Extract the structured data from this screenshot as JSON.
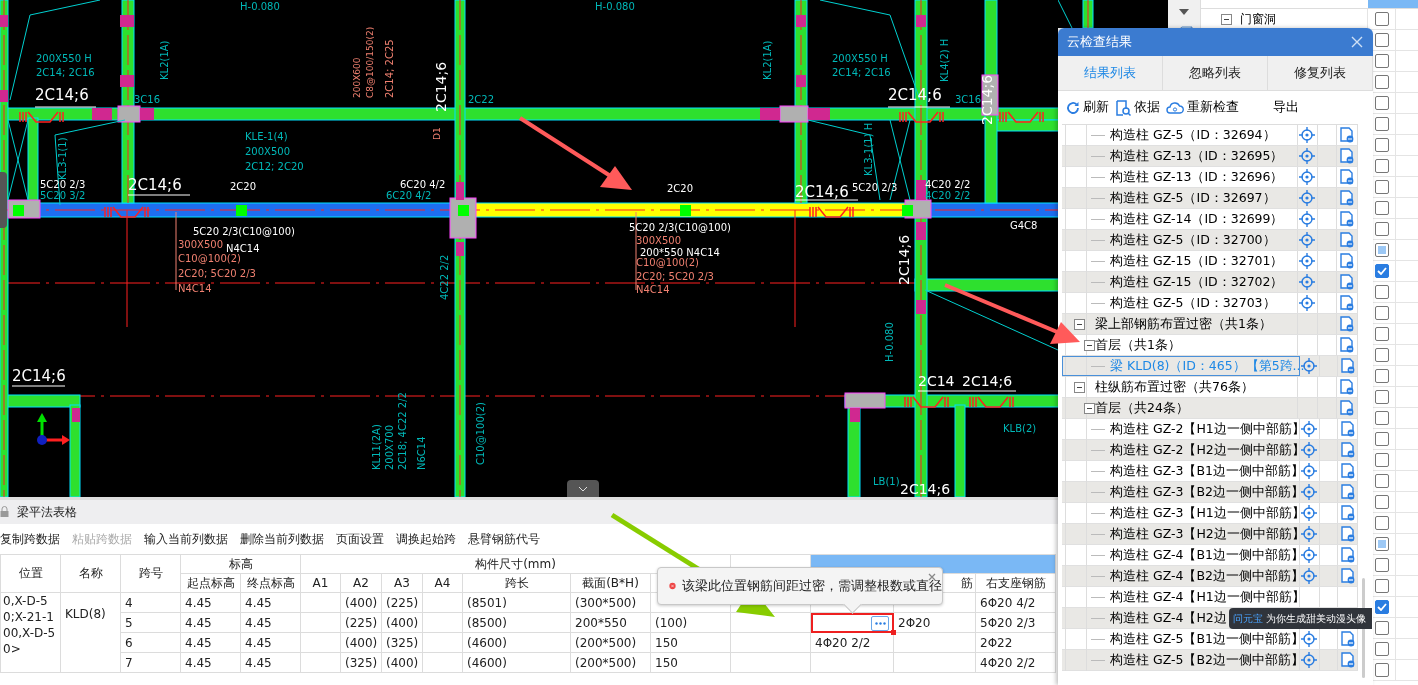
{
  "cad": {
    "labels": [
      {
        "text": "H-0.080",
        "kind": "tag"
      },
      {
        "text": "200X550 H",
        "kind": "tag"
      },
      {
        "text": "2C14; 2C16",
        "kind": "tag"
      },
      {
        "text": "KL2(1A)",
        "kind": "tag"
      },
      {
        "text": "2C14;6",
        "kind": "rebar"
      },
      {
        "text": "3C16",
        "kind": "tag"
      },
      {
        "text": "200X600",
        "kind": "note"
      },
      {
        "text": "C8@100/150(2)",
        "kind": "note"
      },
      {
        "text": "2C14; 2C25",
        "kind": "note"
      },
      {
        "text": "2C14;6",
        "kind": "rebar"
      },
      {
        "text": "2C22",
        "kind": "tag"
      },
      {
        "text": "D1",
        "kind": "note"
      },
      {
        "text": "KLE-1(4)",
        "kind": "tag"
      },
      {
        "text": "200X500",
        "kind": "tag"
      },
      {
        "text": "2C12; 2C20",
        "kind": "tag"
      },
      {
        "text": "KL3-1(1)",
        "kind": "tag"
      },
      {
        "text": "5C20 2/3",
        "kind": "rebar"
      },
      {
        "text": "5C20 3/2",
        "kind": "tag"
      },
      {
        "text": "2C14;6",
        "kind": "rebar"
      },
      {
        "text": "2C20",
        "kind": "rebar"
      },
      {
        "text": "6C20 4/2",
        "kind": "rebar"
      },
      {
        "text": "6C20 4/2",
        "kind": "tag"
      },
      {
        "text": "5C20 2/3(C10@100)",
        "kind": "rebar"
      },
      {
        "text": "300X500",
        "kind": "note"
      },
      {
        "text": "N4C14",
        "kind": "rebar"
      },
      {
        "text": "C10@100(2)",
        "kind": "note"
      },
      {
        "text": "2C20; 5C20 2/3",
        "kind": "note"
      },
      {
        "text": "N4C14",
        "kind": "note"
      },
      {
        "text": "4C22 2/2",
        "kind": "tag"
      },
      {
        "text": "2C14;6",
        "kind": "rebar"
      },
      {
        "text": "KL11(2A)",
        "kind": "tag"
      },
      {
        "text": "200X700",
        "kind": "tag"
      },
      {
        "text": "2C18; 4C22 2/2",
        "kind": "tag"
      },
      {
        "text": "N6C14",
        "kind": "tag"
      },
      {
        "text": "C10@100(2)",
        "kind": "tag"
      },
      {
        "text": "H-0.080",
        "kind": "tag"
      },
      {
        "text": "KL2(1A)",
        "kind": "tag"
      },
      {
        "text": "200X550 H",
        "kind": "tag"
      },
      {
        "text": "2C14; 2C16",
        "kind": "tag"
      },
      {
        "text": "KL4(2) H",
        "kind": "tag"
      },
      {
        "text": "2C14;6",
        "kind": "rebar"
      },
      {
        "text": "3C16",
        "kind": "tag"
      },
      {
        "text": "2C14;6",
        "kind": "rebar"
      },
      {
        "text": "KL3-1(1) H",
        "kind": "tag"
      },
      {
        "text": "2C20",
        "kind": "rebar"
      },
      {
        "text": "2C14;6",
        "kind": "rebar"
      },
      {
        "text": "5C20 2/3",
        "kind": "rebar"
      },
      {
        "text": "4C20 2/2",
        "kind": "rebar"
      },
      {
        "text": "4C20 2/2",
        "kind": "tag"
      },
      {
        "text": "5C20 2/3(C10@100)",
        "kind": "rebar"
      },
      {
        "text": "300X500",
        "kind": "note"
      },
      {
        "text": "200*550 N4C14",
        "kind": "rebar"
      },
      {
        "text": "C10@100(2)",
        "kind": "note"
      },
      {
        "text": "2C20; 5C20 2/3",
        "kind": "note"
      },
      {
        "text": "N4C14",
        "kind": "note"
      },
      {
        "text": "G4C8",
        "kind": "rebar"
      },
      {
        "text": "2C14;6",
        "kind": "rebar"
      },
      {
        "text": "H-0.080",
        "kind": "tag"
      },
      {
        "text": "2C14",
        "kind": "rebar"
      },
      {
        "text": "2C14;6",
        "kind": "rebar"
      },
      {
        "text": "KLB(2)",
        "kind": "tag"
      },
      {
        "text": "LB(1)",
        "kind": "tag"
      },
      {
        "text": "2C14;6",
        "kind": "rebar"
      }
    ]
  },
  "beam_table": {
    "title": "梁平法表格",
    "toolbar": [
      {
        "label": "复制跨数据",
        "disabled": false
      },
      {
        "label": "粘贴跨数据",
        "disabled": true
      },
      {
        "label": "输入当前列数据",
        "disabled": false
      },
      {
        "label": "删除当前列数据",
        "disabled": false
      },
      {
        "label": "页面设置",
        "disabled": false
      },
      {
        "label": "调换起始跨",
        "disabled": false
      },
      {
        "label": "悬臂钢筋代号",
        "disabled": false
      }
    ],
    "headers": {
      "position": "位置",
      "name": "名称",
      "span_no": "跨号",
      "elevation": "标高",
      "start_elev": "起点标高",
      "end_elev": "终点标高",
      "size": "构件尺寸(mm)",
      "a1": "A1",
      "a2": "A2",
      "a3": "A3",
      "a4": "A4",
      "span_length": "跨长",
      "section": "截面(B*H)",
      "column_13": "筋",
      "right_support": "右支座钢筋"
    },
    "position": "0,X-D-50;X-21-100,X-D-50>",
    "name": "KLD(8)",
    "rows": [
      {
        "span_no": "4",
        "start_elev": "4.45",
        "end_elev": "4.45",
        "a2": "(400)",
        "a3": "(225)",
        "span_length": "(8501)",
        "section": "(300*500)",
        "right_support": "6Φ20 4/2",
        "selected": false
      },
      {
        "span_no": "5",
        "start_elev": "4.45",
        "end_elev": "4.45",
        "a2": "(225)",
        "a3": "(400)",
        "span_length": "(8500)",
        "section": "200*550",
        "column_10": "(100)",
        "column_13": "2Φ20",
        "right_support": "5Φ20 2/3",
        "selected": true
      },
      {
        "span_no": "6",
        "start_elev": "4.45",
        "end_elev": "4.45",
        "a2": "(400)",
        "a3": "(325)",
        "span_length": "(4600)",
        "section": "(200*500)",
        "column_10": "150",
        "column_12": "4Φ20 2/2",
        "right_support": "2Φ22",
        "selected": false
      },
      {
        "span_no": "7",
        "start_elev": "4.45",
        "end_elev": "4.45",
        "a2": "(325)",
        "a3": "(400)",
        "span_length": "(4600)",
        "section": "(200*500)",
        "column_10": "150",
        "right_support": "4Φ20 2/2",
        "selected": false
      }
    ],
    "error_tip": "该梁此位置钢筋间距过密，需调整根数或直径"
  },
  "layer_panel": {
    "rows": [
      {
        "label": "门窗洞",
        "checked": false,
        "partial": false
      },
      {
        "checked": false,
        "partial": false
      },
      {
        "checked": false,
        "partial": false
      },
      {
        "checked": false,
        "partial": false
      },
      {
        "checked": false,
        "partial": false
      },
      {
        "checked": false,
        "partial": false
      },
      {
        "checked": false,
        "partial": false
      },
      {
        "checked": false,
        "partial": false
      },
      {
        "checked": false,
        "partial": false
      },
      {
        "checked": false,
        "partial": false
      },
      {
        "checked": false,
        "partial": false
      },
      {
        "checked": false,
        "partial": true
      },
      {
        "checked": true,
        "partial": false
      },
      {
        "checked": false,
        "partial": false
      },
      {
        "checked": false,
        "partial": false
      },
      {
        "checked": false,
        "partial": false
      },
      {
        "checked": false,
        "partial": false
      },
      {
        "checked": false,
        "partial": false
      },
      {
        "checked": false,
        "partial": false
      },
      {
        "checked": false,
        "partial": false
      },
      {
        "checked": false,
        "partial": false
      },
      {
        "checked": false,
        "partial": false
      },
      {
        "checked": false,
        "partial": false
      },
      {
        "checked": false,
        "partial": false
      },
      {
        "checked": false,
        "partial": false
      },
      {
        "checked": false,
        "partial": true
      },
      {
        "checked": false,
        "partial": false
      },
      {
        "checked": false,
        "partial": false
      },
      {
        "checked": true,
        "partial": false
      },
      {
        "checked": false,
        "partial": false
      },
      {
        "checked": false,
        "partial": false
      },
      {
        "checked": false,
        "partial": false
      }
    ]
  },
  "dialog": {
    "title": "云检查结果",
    "tabs": [
      {
        "label": "结果列表",
        "selected": true
      },
      {
        "label": "忽略列表",
        "selected": false
      },
      {
        "label": "修复列表",
        "selected": false
      }
    ],
    "toolbar": [
      {
        "label": "刷新",
        "kind": "refresh"
      },
      {
        "label": "依据",
        "kind": "basis"
      },
      {
        "label": "重新检查",
        "kind": "cloud"
      },
      {
        "label": "导出",
        "kind": "plain"
      }
    ],
    "leading_items": [
      {
        "label": "构造柱 GZ-5（ID：32694）",
        "selected": false
      },
      {
        "label": "构造柱 GZ-13（ID：32695）",
        "selected": false
      },
      {
        "label": "构造柱 GZ-13（ID：32696）",
        "selected": false
      },
      {
        "label": "构造柱 GZ-5（ID：32697）",
        "selected": false
      },
      {
        "label": "构造柱 GZ-14（ID：32699）",
        "selected": false
      },
      {
        "label": "构造柱 GZ-5（ID：32700）",
        "selected": false
      },
      {
        "label": "构造柱 GZ-15（ID：32701）",
        "selected": false
      },
      {
        "label": "构造柱 GZ-15（ID：32702）",
        "selected": false
      },
      {
        "label": "构造柱 GZ-5（ID：32703）",
        "selected": false
      }
    ],
    "groups": [
      {
        "label": "梁上部钢筋布置过密（共1条）",
        "expanded": true,
        "children": [
          {
            "label": "首层（共1条）",
            "expanded": true,
            "children": [
              {
                "label": "梁 KLD(8)（ID：465）【第5跨...",
                "selected": true
              }
            ]
          }
        ]
      },
      {
        "label": "柱纵筋布置过密（共76条）",
        "expanded": true,
        "children": [
          {
            "label": "首层（共24条）",
            "expanded": true,
            "children": [
              {
                "label": "构造柱 GZ-2【H1边一侧中部筋】",
                "selected": false
              },
              {
                "label": "构造柱 GZ-2【H2边一侧中部筋】",
                "selected": false
              },
              {
                "label": "构造柱 GZ-3【B1边一侧中部筋】",
                "selected": false
              },
              {
                "label": "构造柱 GZ-3【B2边一侧中部筋】",
                "selected": false
              },
              {
                "label": "构造柱 GZ-3【H1边一侧中部筋】",
                "selected": false
              },
              {
                "label": "构造柱 GZ-3【H2边一侧中部筋】",
                "selected": false
              },
              {
                "label": "构造柱 GZ-4【B1边一侧中部筋】",
                "selected": false
              },
              {
                "label": "构造柱 GZ-4【B2边一侧中部筋】",
                "selected": false
              },
              {
                "label": "构造柱 GZ-4【H1边一侧中部筋】",
                "selected": false
              },
              {
                "label": "构造柱 GZ-4【H2边",
                "selected": false
              },
              {
                "label": "构造柱 GZ-5【B1边一侧中部筋】",
                "selected": false
              },
              {
                "label": "构造柱 GZ-5【B2边一侧中部筋】",
                "selected": false
              }
            ]
          }
        ]
      }
    ]
  },
  "toast": {
    "brand": "问元宝",
    "message": "为你生成甜美动漫头像"
  }
}
